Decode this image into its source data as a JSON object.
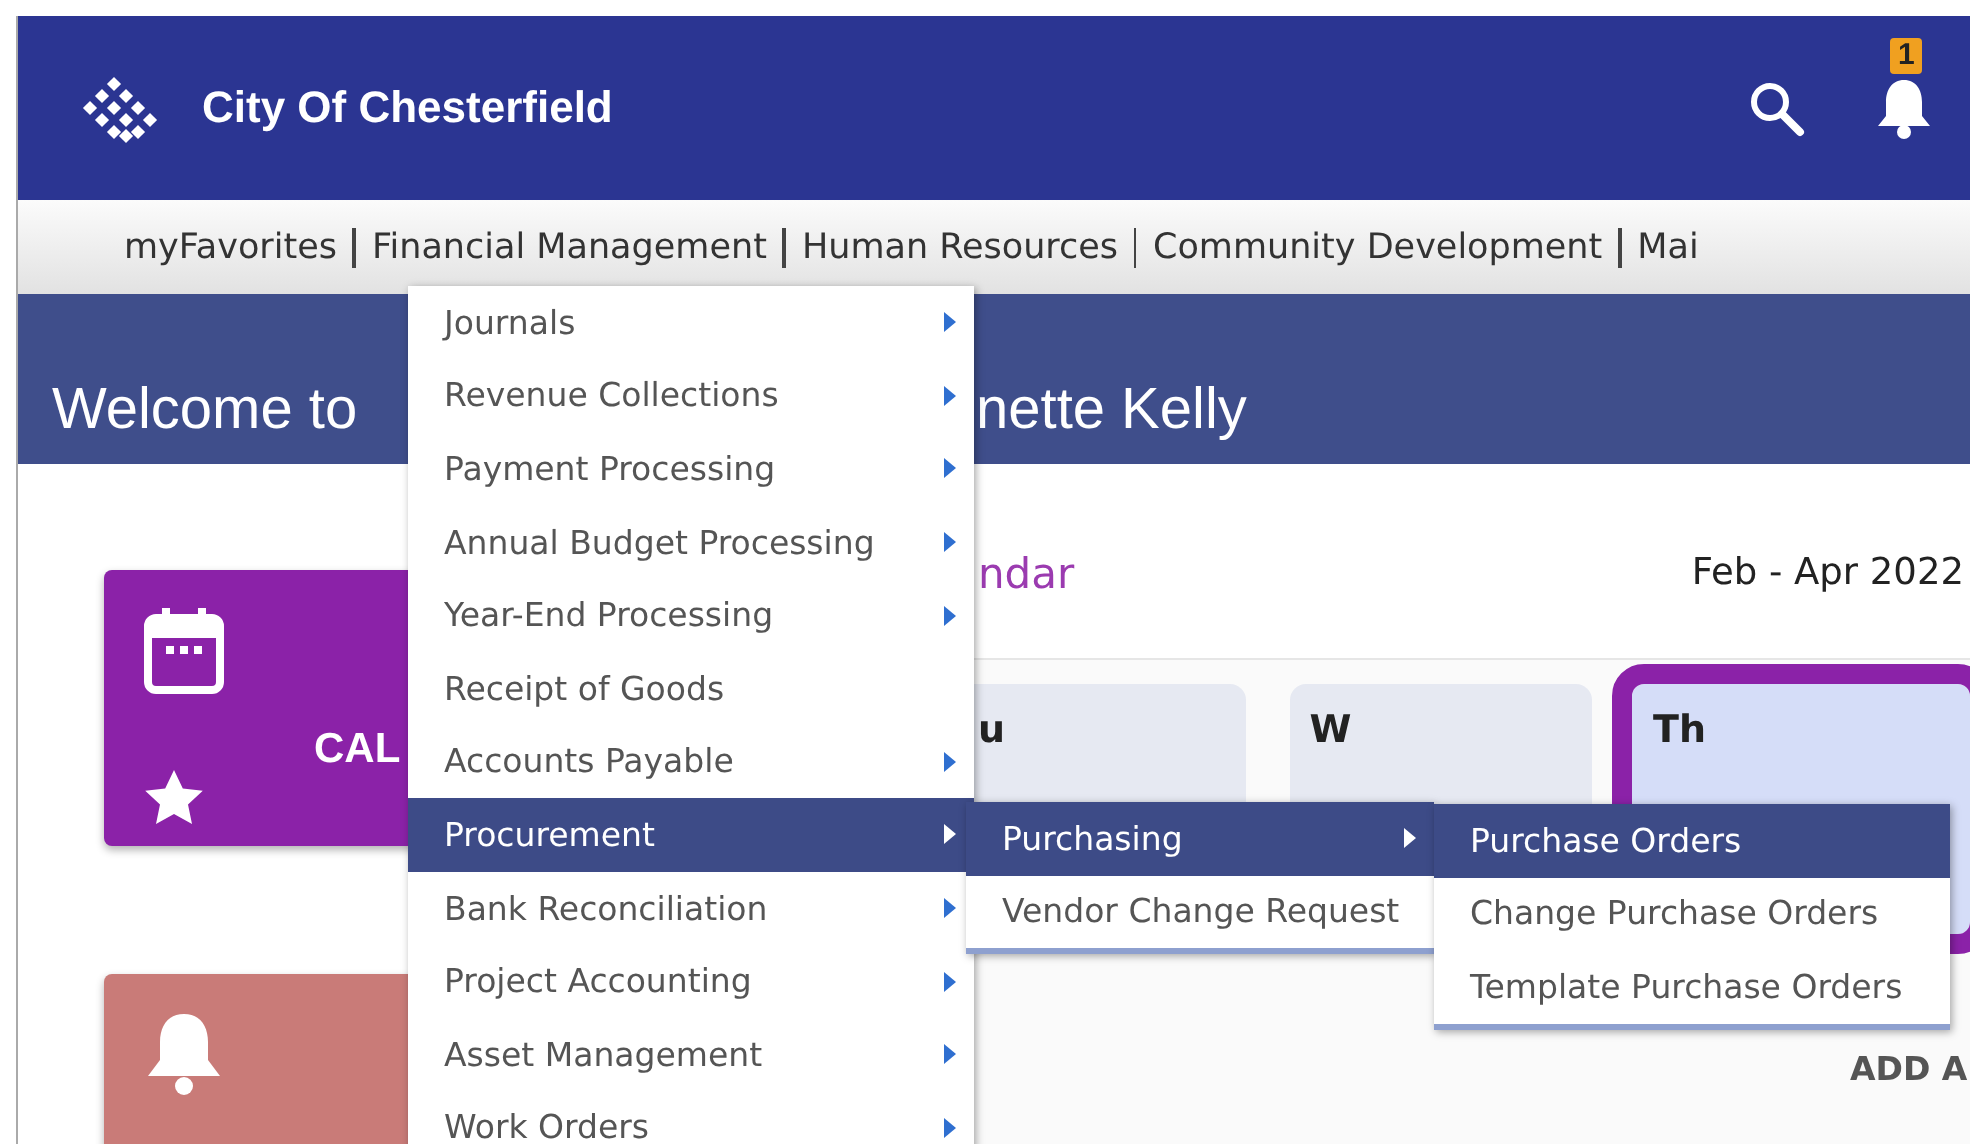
{
  "header": {
    "title": "City Of Chesterfield",
    "badge": "1"
  },
  "nav": [
    "myFavorites",
    "Financial Management",
    "Human Resources",
    "Community Development",
    "Mai"
  ],
  "welcome": {
    "text_left": "Welcome to",
    "text_right": "nette Kelly"
  },
  "tiles": [
    {
      "kind": "calendar",
      "label": "CAL"
    },
    {
      "kind": "notifications"
    }
  ],
  "calendar": {
    "title": "ndar",
    "range": "Feb - Apr 2022",
    "add_label": "ADD A",
    "days": [
      {
        "label": "u",
        "selected": false
      },
      {
        "label": "W",
        "selected": false
      },
      {
        "label": "Th",
        "selected": true
      }
    ]
  },
  "menus": [
    {
      "items": [
        {
          "label": "Journals",
          "submenu": true,
          "selected": false
        },
        {
          "label": "Revenue Collections",
          "submenu": true,
          "selected": false
        },
        {
          "label": "Payment Processing",
          "submenu": true,
          "selected": false
        },
        {
          "label": "Annual Budget Processing",
          "submenu": true,
          "selected": false
        },
        {
          "label": "Year-End Processing",
          "submenu": true,
          "selected": false
        },
        {
          "label": "Receipt of Goods",
          "submenu": false,
          "selected": false
        },
        {
          "label": "Accounts Payable",
          "submenu": true,
          "selected": false
        },
        {
          "label": "Procurement",
          "submenu": true,
          "selected": true
        },
        {
          "label": "Bank Reconciliation",
          "submenu": true,
          "selected": false
        },
        {
          "label": "Project Accounting",
          "submenu": true,
          "selected": false
        },
        {
          "label": "Asset Management",
          "submenu": true,
          "selected": false
        },
        {
          "label": "Work Orders",
          "submenu": true,
          "selected": false
        }
      ]
    },
    {
      "items": [
        {
          "label": "Purchasing",
          "submenu": true,
          "selected": true
        },
        {
          "label": "Vendor Change Request",
          "submenu": false,
          "selected": false
        }
      ]
    },
    {
      "items": [
        {
          "label": "Purchase Orders",
          "submenu": false,
          "selected": true
        },
        {
          "label": "Change Purchase Orders",
          "submenu": false,
          "selected": false
        },
        {
          "label": "Template Purchase Orders",
          "submenu": false,
          "selected": false
        }
      ]
    }
  ]
}
